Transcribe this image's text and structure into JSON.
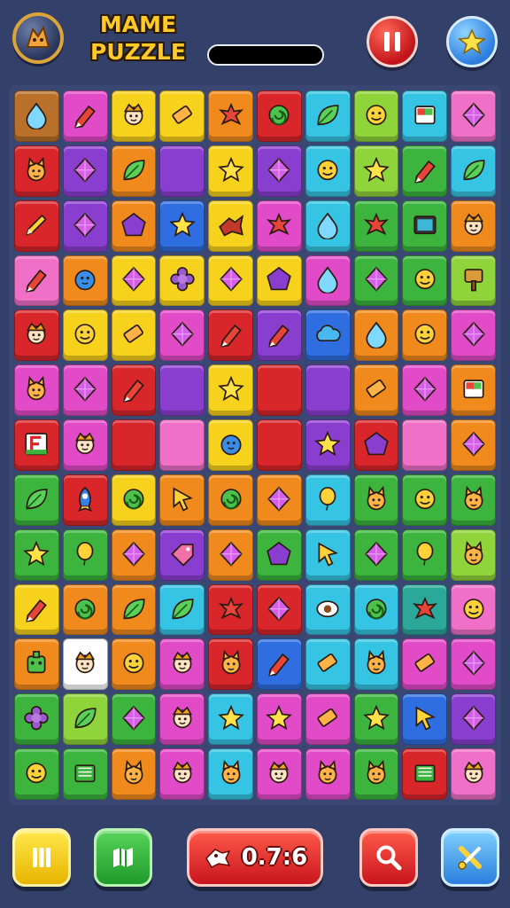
{
  "header": {
    "title_line1": "MAME",
    "title_line2": "PUZZLE",
    "progress": 0
  },
  "colors": {
    "red": "#d8262b",
    "orange": "#f08a1c",
    "yellow": "#f7d21c",
    "green": "#3cb43e",
    "lime": "#8fd43a",
    "cyan": "#35c4e4",
    "blue": "#2f6ee0",
    "purple": "#8a3ed0",
    "magenta": "#e24bc8",
    "pink": "#f070c8",
    "brown": "#b8702a",
    "teal": "#2ba89a"
  },
  "board": {
    "rows": [
      [
        [
          "brown",
          "drop-icon"
        ],
        [
          "magenta",
          "crayon-icon"
        ],
        [
          "yellow",
          "character-icon"
        ],
        [
          "yellow",
          "eraser-icon"
        ],
        [
          "orange",
          "splash-icon"
        ],
        [
          "red",
          "swirl-icon"
        ],
        [
          "cyan",
          "leaf-icon"
        ],
        [
          "lime",
          "face-icon"
        ],
        [
          "cyan",
          "box-icon"
        ],
        [
          "pink",
          "gem-icon"
        ]
      ],
      [
        [
          "red",
          "creature-icon"
        ],
        [
          "purple",
          "gem-icon"
        ],
        [
          "orange",
          "leaf-icon"
        ],
        [
          "purple",
          ""
        ],
        [
          "yellow",
          "star-icon"
        ],
        [
          "purple",
          "gem-icon"
        ],
        [
          "cyan",
          "face-icon"
        ],
        [
          "lime",
          "star-icon"
        ],
        [
          "green",
          "crayon-icon"
        ],
        [
          "cyan",
          "leaf-icon"
        ]
      ],
      [
        [
          "red",
          "pencil-icon"
        ],
        [
          "purple",
          "gem-icon"
        ],
        [
          "orange",
          "pentagon-icon"
        ],
        [
          "blue",
          "star-icon"
        ],
        [
          "yellow",
          "bird-icon"
        ],
        [
          "magenta",
          "splash-icon"
        ],
        [
          "cyan",
          "drop-icon"
        ],
        [
          "green",
          "splash-icon"
        ],
        [
          "green",
          "tv-icon"
        ],
        [
          "orange",
          "character-icon"
        ]
      ],
      [
        [
          "pink",
          "crayon-icon"
        ],
        [
          "orange",
          "ball-icon"
        ],
        [
          "yellow",
          "gem-icon"
        ],
        [
          "yellow",
          "flower-icon"
        ],
        [
          "yellow",
          "gem-icon"
        ],
        [
          "yellow",
          "pentagon-icon"
        ],
        [
          "magenta",
          "drop-icon"
        ],
        [
          "green",
          "gem-icon"
        ],
        [
          "green",
          "face-icon"
        ],
        [
          "lime",
          "sign-icon"
        ]
      ],
      [
        [
          "red",
          "character-icon"
        ],
        [
          "yellow",
          "face-icon"
        ],
        [
          "yellow",
          "eraser-icon"
        ],
        [
          "magenta",
          "gem-icon"
        ],
        [
          "red",
          "crayon-icon"
        ],
        [
          "purple",
          "crayon-icon"
        ],
        [
          "blue",
          "cloud-icon"
        ],
        [
          "orange",
          "drop-icon"
        ],
        [
          "orange",
          "face-icon"
        ],
        [
          "magenta",
          "gem-icon"
        ]
      ],
      [
        [
          "magenta",
          "creature-icon"
        ],
        [
          "magenta",
          "gem-icon"
        ],
        [
          "red",
          "crayon-icon"
        ],
        [
          "purple",
          ""
        ],
        [
          "yellow",
          "star-icon"
        ],
        [
          "red",
          ""
        ],
        [
          "purple",
          ""
        ],
        [
          "orange",
          "eraser-icon"
        ],
        [
          "magenta",
          "gem-icon"
        ],
        [
          "orange",
          "box-icon"
        ]
      ],
      [
        [
          "red",
          "flag-icon"
        ],
        [
          "magenta",
          "character-icon"
        ],
        [
          "red",
          ""
        ],
        [
          "pink",
          ""
        ],
        [
          "yellow",
          "ball-icon"
        ],
        [
          "red",
          ""
        ],
        [
          "purple",
          "star-icon"
        ],
        [
          "red",
          "pentagon-icon"
        ],
        [
          "pink",
          ""
        ],
        [
          "orange",
          "gem-icon"
        ]
      ],
      [
        [
          "green",
          "leaf-icon"
        ],
        [
          "red",
          "rocket-icon"
        ],
        [
          "yellow",
          "swirl-icon"
        ],
        [
          "orange",
          "cursor-icon"
        ],
        [
          "orange",
          "swirl-icon"
        ],
        [
          "orange",
          "gem-icon"
        ],
        [
          "cyan",
          "balloon-icon"
        ],
        [
          "green",
          "creature-icon"
        ],
        [
          "green",
          "face-icon"
        ],
        [
          "green",
          "creature-icon"
        ]
      ],
      [
        [
          "green",
          "star-icon"
        ],
        [
          "green",
          "balloon-icon"
        ],
        [
          "orange",
          "gem-icon"
        ],
        [
          "purple",
          "tag-icon"
        ],
        [
          "orange",
          "gem-icon"
        ],
        [
          "green",
          "pentagon-icon"
        ],
        [
          "cyan",
          "cursor-icon"
        ],
        [
          "green",
          "gem-icon"
        ],
        [
          "green",
          "balloon-icon"
        ],
        [
          "lime",
          "creature-icon"
        ]
      ],
      [
        [
          "yellow",
          "crayon-icon"
        ],
        [
          "orange",
          "swirl-icon"
        ],
        [
          "orange",
          "leaf-icon"
        ],
        [
          "cyan",
          "leaf-icon"
        ],
        [
          "red",
          "splash-icon"
        ],
        [
          "red",
          "gem-icon"
        ],
        [
          "cyan",
          "eye-icon"
        ],
        [
          "cyan",
          "swirl-icon"
        ],
        [
          "teal",
          "splash-icon"
        ],
        [
          "pink",
          "face-icon"
        ]
      ],
      [
        [
          "orange",
          "robot-icon"
        ],
        [
          "white",
          "character-icon"
        ],
        [
          "orange",
          "face-icon"
        ],
        [
          "magenta",
          "character-icon"
        ],
        [
          "red",
          "creature-icon"
        ],
        [
          "blue",
          "crayon-icon"
        ],
        [
          "cyan",
          "eraser-icon"
        ],
        [
          "cyan",
          "creature-icon"
        ],
        [
          "magenta",
          "eraser-icon"
        ],
        [
          "magenta",
          "gem-icon"
        ]
      ],
      [
        [
          "green",
          "flower-icon"
        ],
        [
          "lime",
          "leaf-icon"
        ],
        [
          "green",
          "gem-icon"
        ],
        [
          "magenta",
          "character-icon"
        ],
        [
          "cyan",
          "star-icon"
        ],
        [
          "magenta",
          "star-icon"
        ],
        [
          "magenta",
          "eraser-icon"
        ],
        [
          "green",
          "star-icon"
        ],
        [
          "blue",
          "cursor-icon"
        ],
        [
          "purple",
          "gem-icon"
        ]
      ],
      [
        [
          "green",
          "face-icon"
        ],
        [
          "green",
          "book-icon"
        ],
        [
          "orange",
          "creature-icon"
        ],
        [
          "magenta",
          "character-icon"
        ],
        [
          "cyan",
          "creature-icon"
        ],
        [
          "magenta",
          "character-icon"
        ],
        [
          "magenta",
          "creature-icon"
        ],
        [
          "green",
          "creature-icon"
        ],
        [
          "red",
          "book-icon"
        ],
        [
          "pink",
          "character-icon"
        ]
      ]
    ]
  },
  "footer": {
    "timer": "0.7:6",
    "buttons": [
      "menu-icon",
      "map-icon",
      "search-icon",
      "tools-icon"
    ]
  }
}
